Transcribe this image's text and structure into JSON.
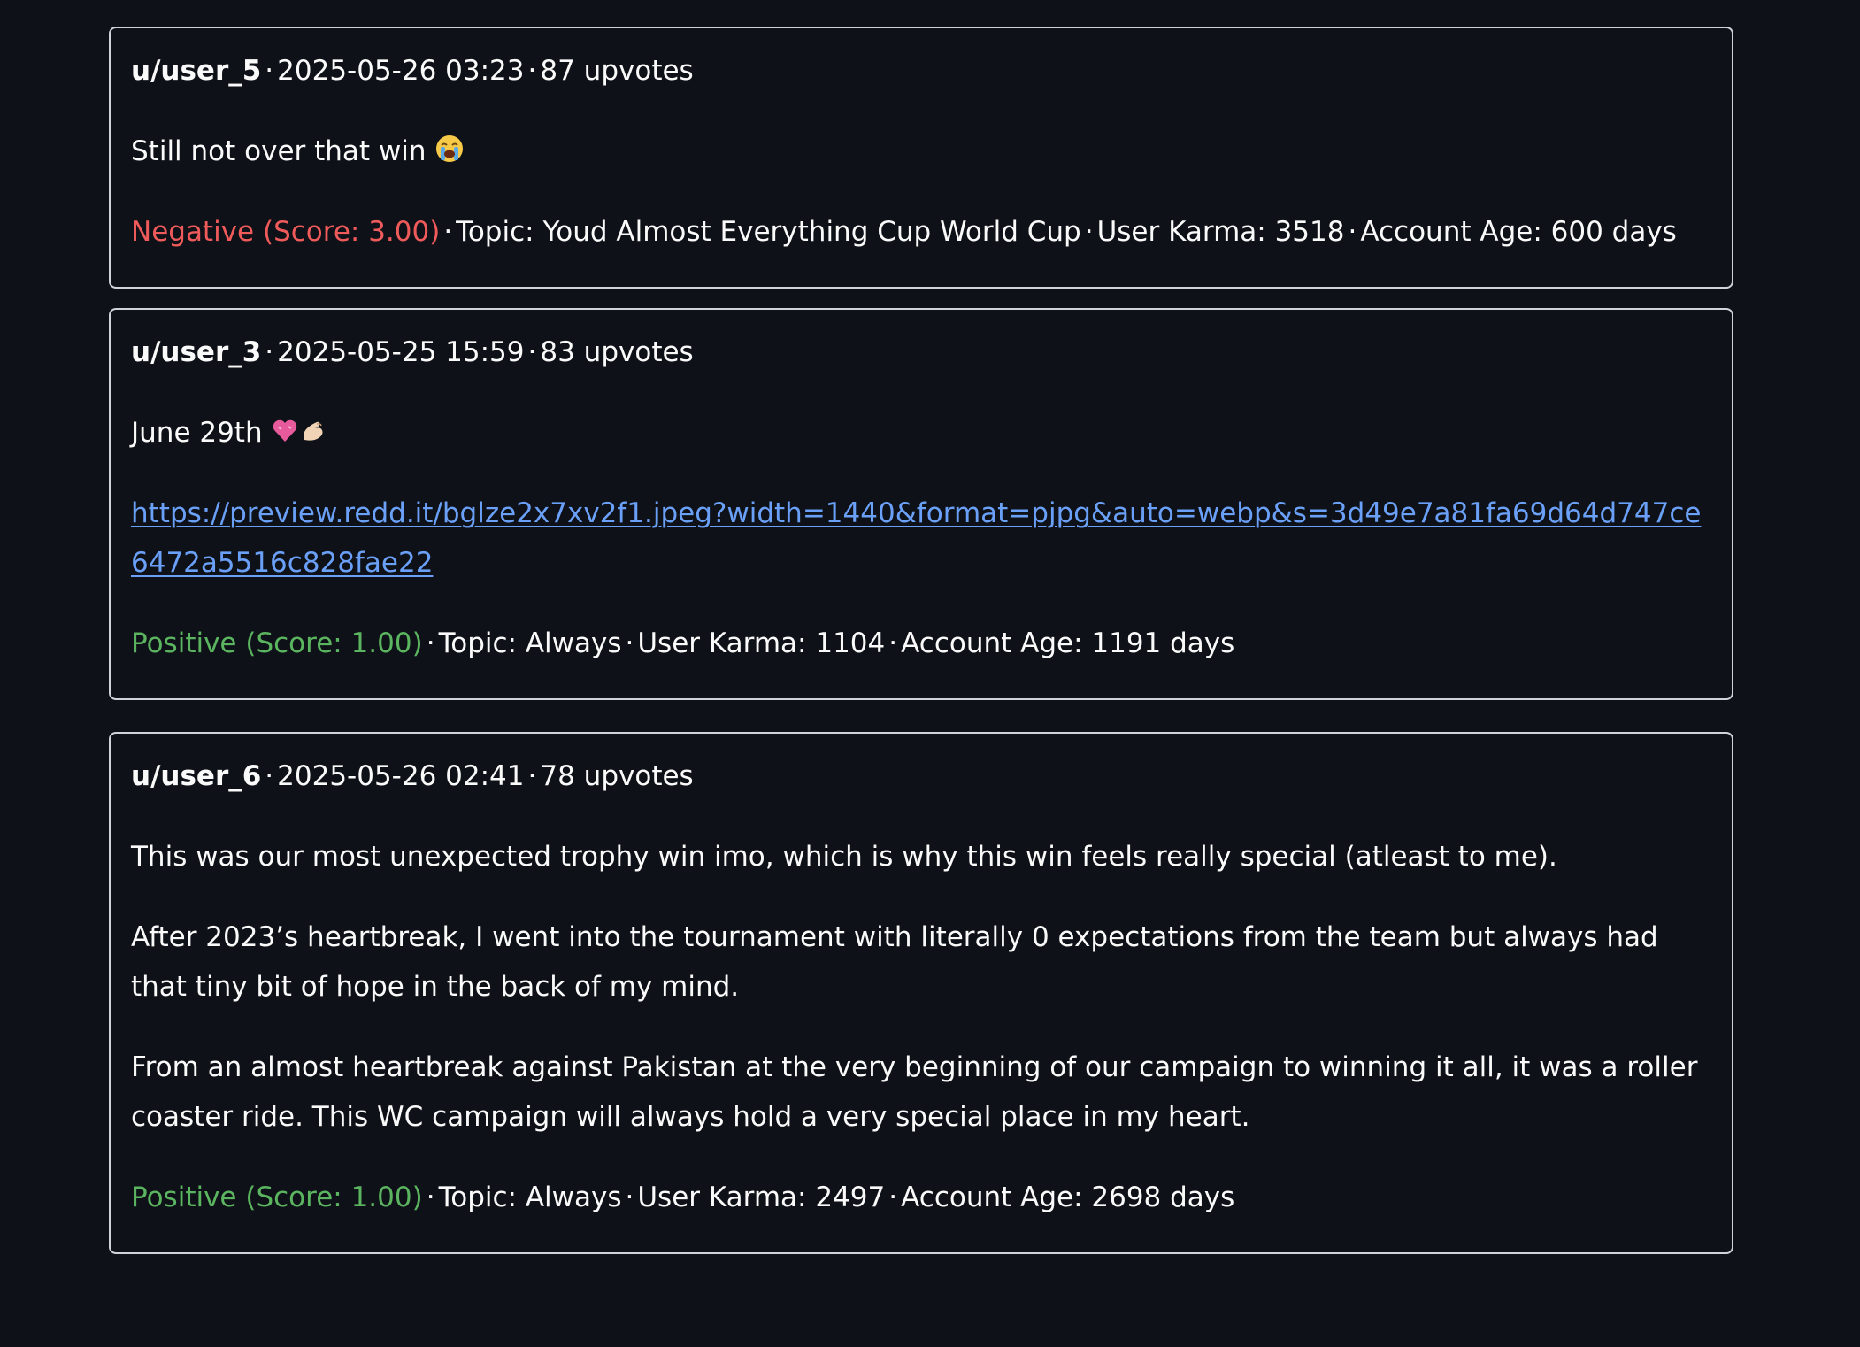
{
  "posts": [
    {
      "author": "u/user_5",
      "timestamp": "2025-05-26 03:23",
      "upvotes": "87 upvotes",
      "body": [
        "Still not over that win"
      ],
      "emoji": "crying-face-emoji",
      "sentiment": "Negative (Score: 3.00)",
      "topic": "Topic: Youd Almost Everything Cup World Cup",
      "karma": "User Karma: 3518",
      "account_age": "Account Age: 600 days"
    },
    {
      "author": "u/user_3",
      "timestamp": "2025-05-25 15:59",
      "upvotes": "83 upvotes",
      "body": [
        "June 29th"
      ],
      "emoji": "pink-heart-and-pinching-hand-emoji",
      "link": "https://preview.redd.it/bglze2x7xv2f1.jpeg?width=1440&format=pjpg&auto=webp&s=3d49e7a81fa69d64d747ce6472a5516c828fae22",
      "sentiment": "Positive (Score: 1.00)",
      "topic": "Topic: Always",
      "karma": "User Karma: 1104",
      "account_age": "Account Age: 1191 days"
    },
    {
      "author": "u/user_6",
      "timestamp": "2025-05-26 02:41",
      "upvotes": "78 upvotes",
      "body": [
        "This was our most unexpected trophy win imo, which is why this win feels really special (atleast to me).",
        "After 2023’s heartbreak, I went into the tournament with literally 0 expectations from the team but always had that tiny bit of hope in the back of my mind.",
        "From an almost heartbreak against Pakistan at the very beginning of our campaign to winning it all, it was a roller coaster ride. This WC campaign will always hold a very special place in my heart."
      ],
      "sentiment": "Positive (Score: 1.00)",
      "topic": "Topic: Always",
      "karma": "User Karma: 2497",
      "account_age": "Account Age: 2698 days"
    }
  ],
  "separator": "·",
  "colors": {
    "background": "#0e1117",
    "border": "#d0d3da",
    "text": "#fafafa",
    "negative": "#ef5b5b",
    "positive": "#5bb45f",
    "link": "#6aa0f7"
  }
}
